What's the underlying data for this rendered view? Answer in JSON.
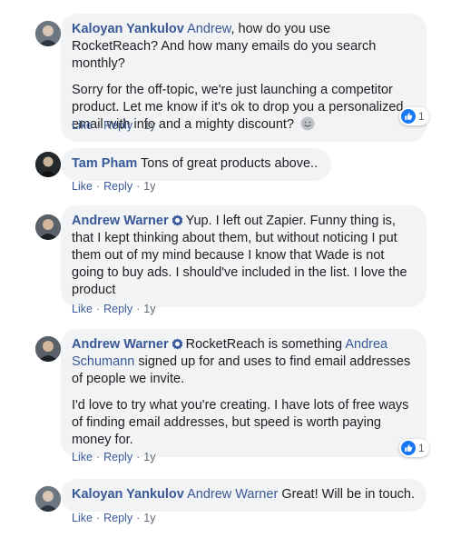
{
  "comments": [
    {
      "author": "Kaloyan Yankulov",
      "tag": "Andrew",
      "p1_rest": ", how do you use RocketReach? And how many emails do you search monthly?",
      "p2": "Sorry for the off-topic, we're just launching a competitor product. Let me know if it's ok to drop you a personalized email with info and a mighty discount?",
      "reaction_count": "1",
      "like": "Like",
      "reply": "Reply",
      "time": "1y"
    },
    {
      "author": "Tam Pham",
      "text": "Tons of great products above..",
      "like": "Like",
      "reply": "Reply",
      "time": "1y"
    },
    {
      "author": "Andrew Warner",
      "text": "Yup. I left out Zapier. Funny thing is, that I kept thinking about them, but without noticing I put them out of my mind because I know that Wade is not going to buy ads. I should've included in the list. I love the product",
      "like": "Like",
      "reply": "Reply",
      "time": "1y"
    },
    {
      "author": "Andrew Warner",
      "p1_a": "RocketReach is something",
      "tag": "Andrea Schumann",
      "p1_b": "signed up for and uses to find email addresses of people we invite.",
      "p2": "I'd love to try what you're creating. I have lots of free ways of finding email addresses, but speed is worth paying money for.",
      "reaction_count": "1",
      "like": "Like",
      "reply": "Reply",
      "time": "1y"
    },
    {
      "author": "Kaloyan Yankulov",
      "tag": "Andrew Warner",
      "text": "Great! Will be in touch.",
      "like": "Like",
      "reply": "Reply",
      "time": "1y"
    }
  ],
  "separator": "·",
  "colors": {
    "name": "#385898",
    "bubble": "#f2f3f5",
    "meta": "#606770",
    "like_badge": "#1877f2"
  },
  "icons": {
    "verified": "verified-badge-icon",
    "emoji": "smiley-emoji-icon",
    "reaction": "thumbs-up-icon"
  }
}
